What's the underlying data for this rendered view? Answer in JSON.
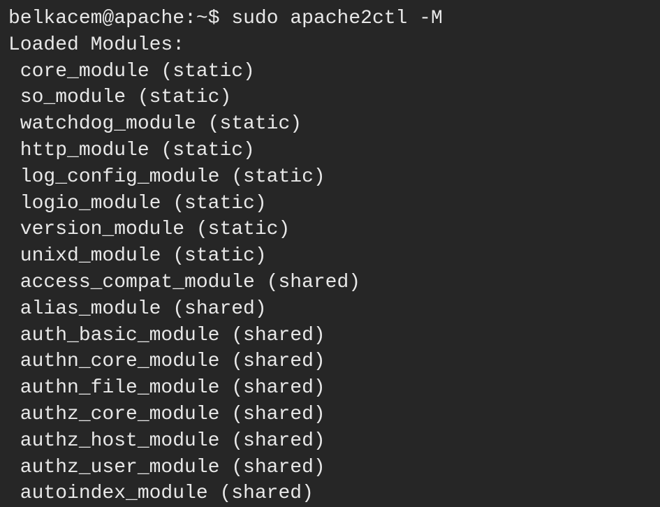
{
  "prompt": {
    "user": "belkacem",
    "host": "apache",
    "path": "~",
    "symbol": "$",
    "command": "sudo apache2ctl -M"
  },
  "output": {
    "header": "Loaded Modules:",
    "modules": [
      {
        "name": "core_module",
        "type": "static"
      },
      {
        "name": "so_module",
        "type": "static"
      },
      {
        "name": "watchdog_module",
        "type": "static"
      },
      {
        "name": "http_module",
        "type": "static"
      },
      {
        "name": "log_config_module",
        "type": "static"
      },
      {
        "name": "logio_module",
        "type": "static"
      },
      {
        "name": "version_module",
        "type": "static"
      },
      {
        "name": "unixd_module",
        "type": "static"
      },
      {
        "name": "access_compat_module",
        "type": "shared"
      },
      {
        "name": "alias_module",
        "type": "shared"
      },
      {
        "name": "auth_basic_module",
        "type": "shared"
      },
      {
        "name": "authn_core_module",
        "type": "shared"
      },
      {
        "name": "authn_file_module",
        "type": "shared"
      },
      {
        "name": "authz_core_module",
        "type": "shared"
      },
      {
        "name": "authz_host_module",
        "type": "shared"
      },
      {
        "name": "authz_user_module",
        "type": "shared"
      },
      {
        "name": "autoindex_module",
        "type": "shared"
      }
    ]
  }
}
